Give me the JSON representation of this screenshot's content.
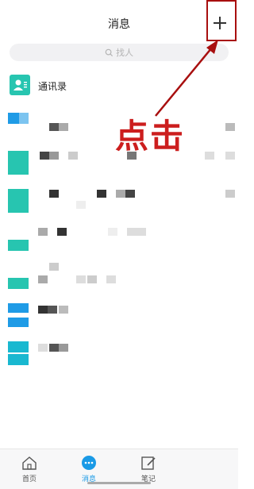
{
  "header": {
    "title": "消息",
    "plus_icon": "plus-icon"
  },
  "search": {
    "placeholder": "找人",
    "icon": "search-icon"
  },
  "contacts_entry": {
    "label": "通讯录",
    "icon": "contacts-book-icon",
    "color": "#27c5b0"
  },
  "annotation": {
    "text": "点击",
    "color": "#cc1e1e"
  },
  "tabs": [
    {
      "label": "首页",
      "icon": "home-icon",
      "active": false
    },
    {
      "label": "消息",
      "icon": "chat-bubble-icon",
      "active": true
    },
    {
      "label": "笔记",
      "icon": "note-edit-icon",
      "active": false
    }
  ],
  "colors": {
    "accent": "#1a9ae6",
    "annotation": "#cc1e1e",
    "teal": "#27c5b0"
  }
}
